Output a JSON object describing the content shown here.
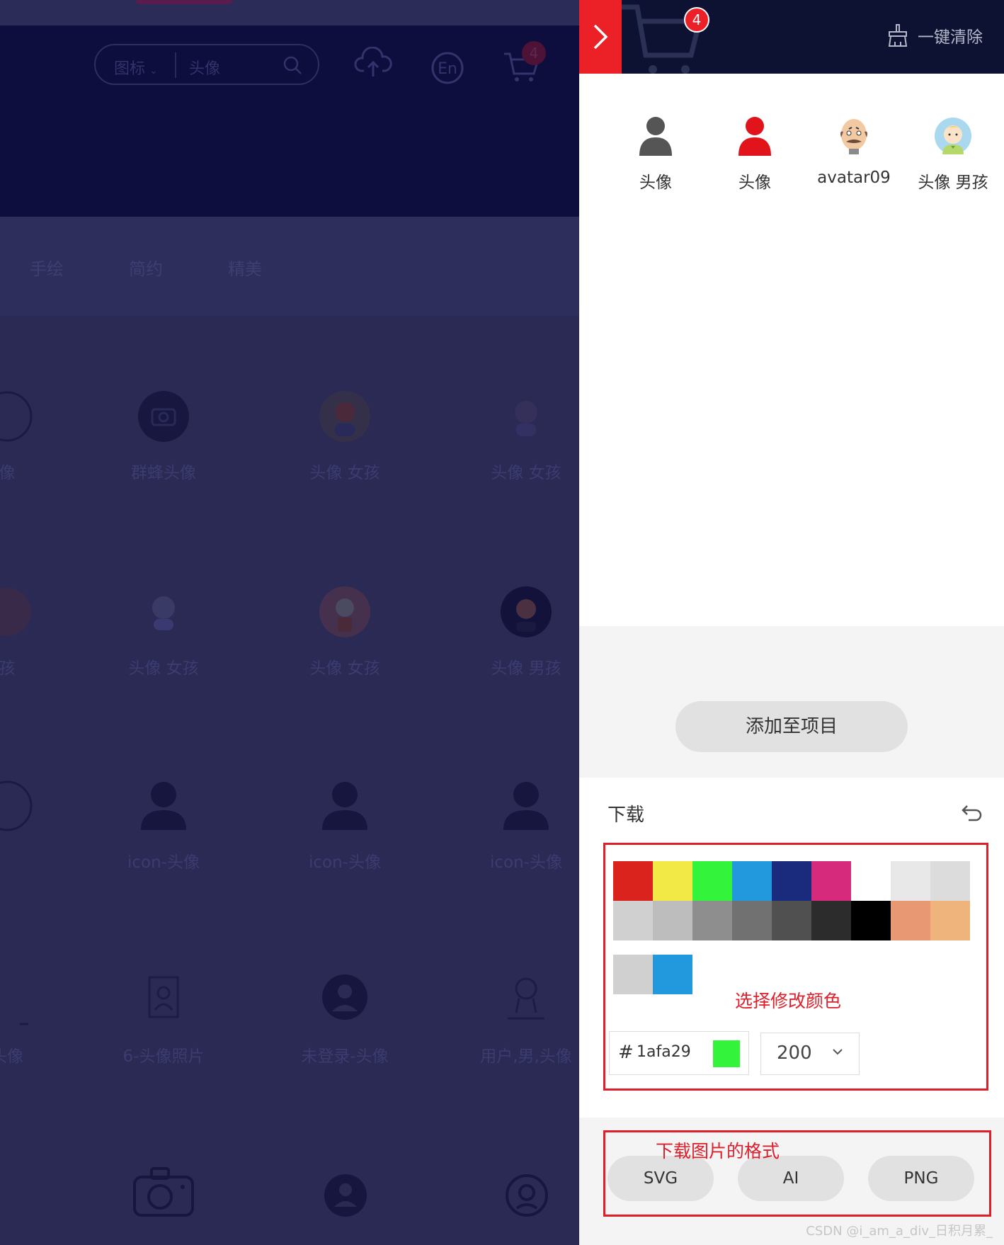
{
  "background": {
    "search": {
      "category": "图标",
      "query": "头像"
    },
    "cart_count": "4",
    "lang": "En",
    "tabs": [
      "手绘",
      "简约",
      "精美"
    ],
    "grid_labels": [
      "像",
      "群蜂头像",
      "头像 女孩",
      "头像 女孩",
      "孩",
      "头像 女孩",
      "头像 女孩",
      "头像 男孩",
      "icon-头像",
      "icon-头像",
      "icon-头像",
      "头像",
      "6-头像照片",
      "未登录-头像",
      "用户,男,头像"
    ]
  },
  "drawer": {
    "cart_count": "4",
    "clear_label": "一键清除",
    "items": [
      {
        "label": "头像",
        "icon": "user-gray-icon",
        "color": "#555555"
      },
      {
        "label": "头像",
        "icon": "user-red-icon",
        "color": "#e1141c"
      },
      {
        "label": "avatar09",
        "icon": "bald-man-avatar-icon"
      },
      {
        "label": "头像 男孩",
        "icon": "boy-avatar-icon"
      }
    ],
    "add_to_project": "添加至项目",
    "download": {
      "title": "下载",
      "palette_row1": [
        "#d9231c",
        "#f3e946",
        "#33f33b",
        "#2299dd",
        "#1a2a7c",
        "#d62b7c",
        "#ffffff",
        "#e8e8e8",
        "#dcdcdc"
      ],
      "palette_row2": [
        "#d0d0d0",
        "#bdbdbd",
        "#8e8e8e",
        "#717171",
        "#505050",
        "#2c2c2c",
        "#000000",
        "#e89873",
        "#efb47b"
      ],
      "recent_colors": [
        "#d0d0d0",
        "#2299dd"
      ],
      "note_color": "选择修改颜色",
      "hex_value": "1afa29",
      "hex_preview": "#33f33b",
      "size_value": "200"
    },
    "formats": {
      "note": "下载图片的格式",
      "buttons": [
        "SVG",
        "AI",
        "PNG"
      ]
    },
    "watermark": "CSDN @i_am_a_div_日积月累_"
  }
}
